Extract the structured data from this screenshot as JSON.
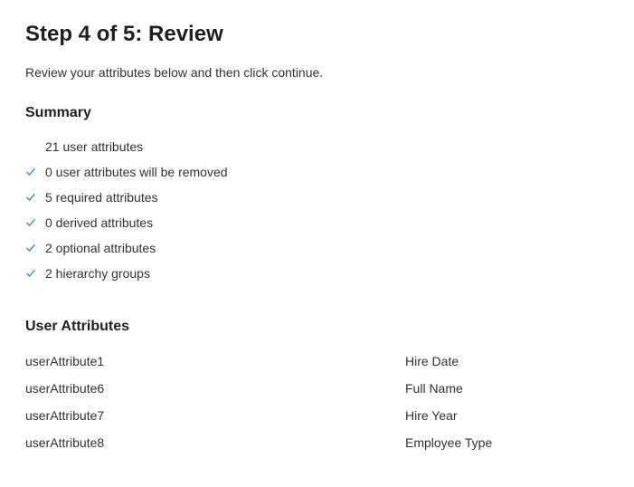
{
  "header": {
    "title": "Step 4 of 5: Review",
    "instruction": "Review your attributes below and then click continue."
  },
  "summary": {
    "heading": "Summary",
    "items": [
      {
        "show_check": false,
        "text": "21 user attributes"
      },
      {
        "show_check": true,
        "text": "0 user attributes will be removed"
      },
      {
        "show_check": true,
        "text": "5 required attributes"
      },
      {
        "show_check": true,
        "text": "0 derived attributes"
      },
      {
        "show_check": true,
        "text": "2 optional attributes"
      },
      {
        "show_check": true,
        "text": "2 hierarchy groups"
      }
    ]
  },
  "userAttributes": {
    "heading": "User Attributes",
    "rows": [
      {
        "left": "userAttribute1",
        "right": "Hire Date"
      },
      {
        "left": "userAttribute6",
        "right": "Full Name"
      },
      {
        "left": "userAttribute7",
        "right": "Hire Year"
      },
      {
        "left": "userAttribute8",
        "right": "Employee Type"
      }
    ]
  }
}
